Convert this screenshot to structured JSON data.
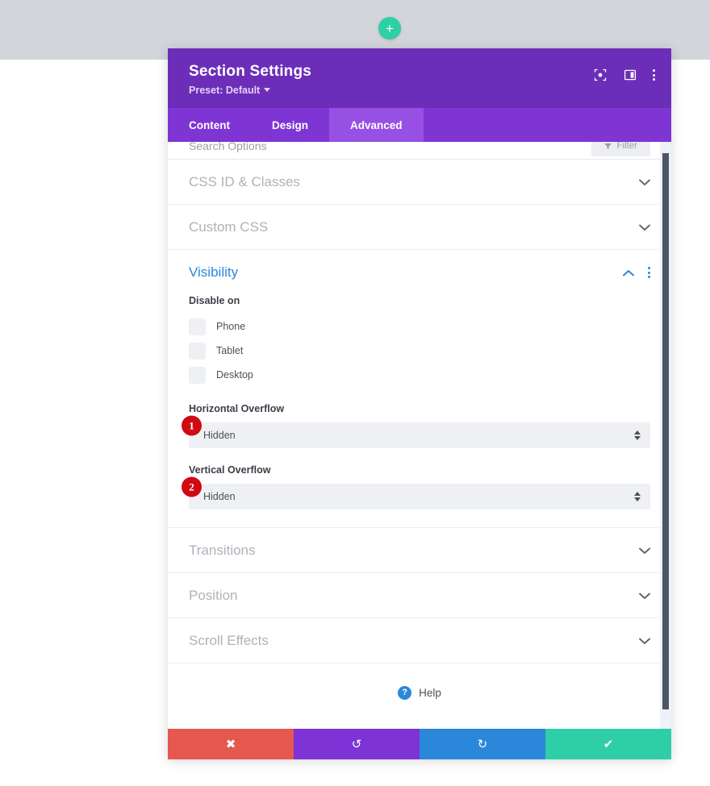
{
  "canvas": {
    "add_button_label": "+",
    "add_button_icon": "plus-icon"
  },
  "modal": {
    "title": "Section Settings",
    "preset_label": "Preset: Default",
    "header_icons": [
      {
        "name": "focus-target-icon",
        "glyph": "target"
      },
      {
        "name": "panel-layout-icon",
        "glyph": "panel"
      },
      {
        "name": "more-options-icon",
        "glyph": "dots"
      }
    ],
    "tabs": [
      {
        "label": "Content",
        "active": false
      },
      {
        "label": "Design",
        "active": false
      },
      {
        "label": "Advanced",
        "active": true
      }
    ],
    "search_row": {
      "label": "Search Options",
      "filter_label": "Filter"
    },
    "sections": [
      {
        "label": "CSS ID & Classes",
        "state": "collapsed",
        "chevron": "chevron-down-icon"
      },
      {
        "label": "Custom CSS",
        "state": "collapsed",
        "chevron": "chevron-down-icon"
      }
    ],
    "open_section": {
      "label": "Visibility",
      "chevron": "chevron-up-icon",
      "menu_icon": "more-options-icon",
      "disable_on": {
        "label": "Disable on",
        "options": [
          {
            "label": "Phone",
            "checked": false
          },
          {
            "label": "Tablet",
            "checked": false
          },
          {
            "label": "Desktop",
            "checked": false
          }
        ]
      },
      "horizontal_overflow": {
        "label": "Horizontal Overflow",
        "value": "Hidden",
        "badge": "1"
      },
      "vertical_overflow": {
        "label": "Vertical Overflow",
        "value": "Hidden",
        "badge": "2"
      }
    },
    "sections_after": [
      {
        "label": "Transitions",
        "state": "collapsed",
        "chevron": "chevron-down-icon"
      },
      {
        "label": "Position",
        "state": "collapsed",
        "chevron": "chevron-down-icon"
      },
      {
        "label": "Scroll Effects",
        "state": "collapsed",
        "chevron": "chevron-down-icon"
      }
    ],
    "help": {
      "label": "Help",
      "icon_glyph": "?"
    },
    "footer": [
      {
        "name": "cancel-button",
        "glyph": "✖",
        "color": "#e4584f"
      },
      {
        "name": "undo-button",
        "glyph": "↺",
        "color": "#7d33d6"
      },
      {
        "name": "redo-button",
        "glyph": "↻",
        "color": "#2b87da"
      },
      {
        "name": "save-button",
        "glyph": "✔",
        "color": "#2ecfa6"
      }
    ]
  },
  "colors": {
    "header_purple": "#6c2eb9",
    "tabs_purple": "#7f35d4",
    "tab_active_purple": "#9650e3",
    "accent_blue": "#2b87da",
    "badge_red": "#cf0a12",
    "teal": "#2ecfa6"
  }
}
